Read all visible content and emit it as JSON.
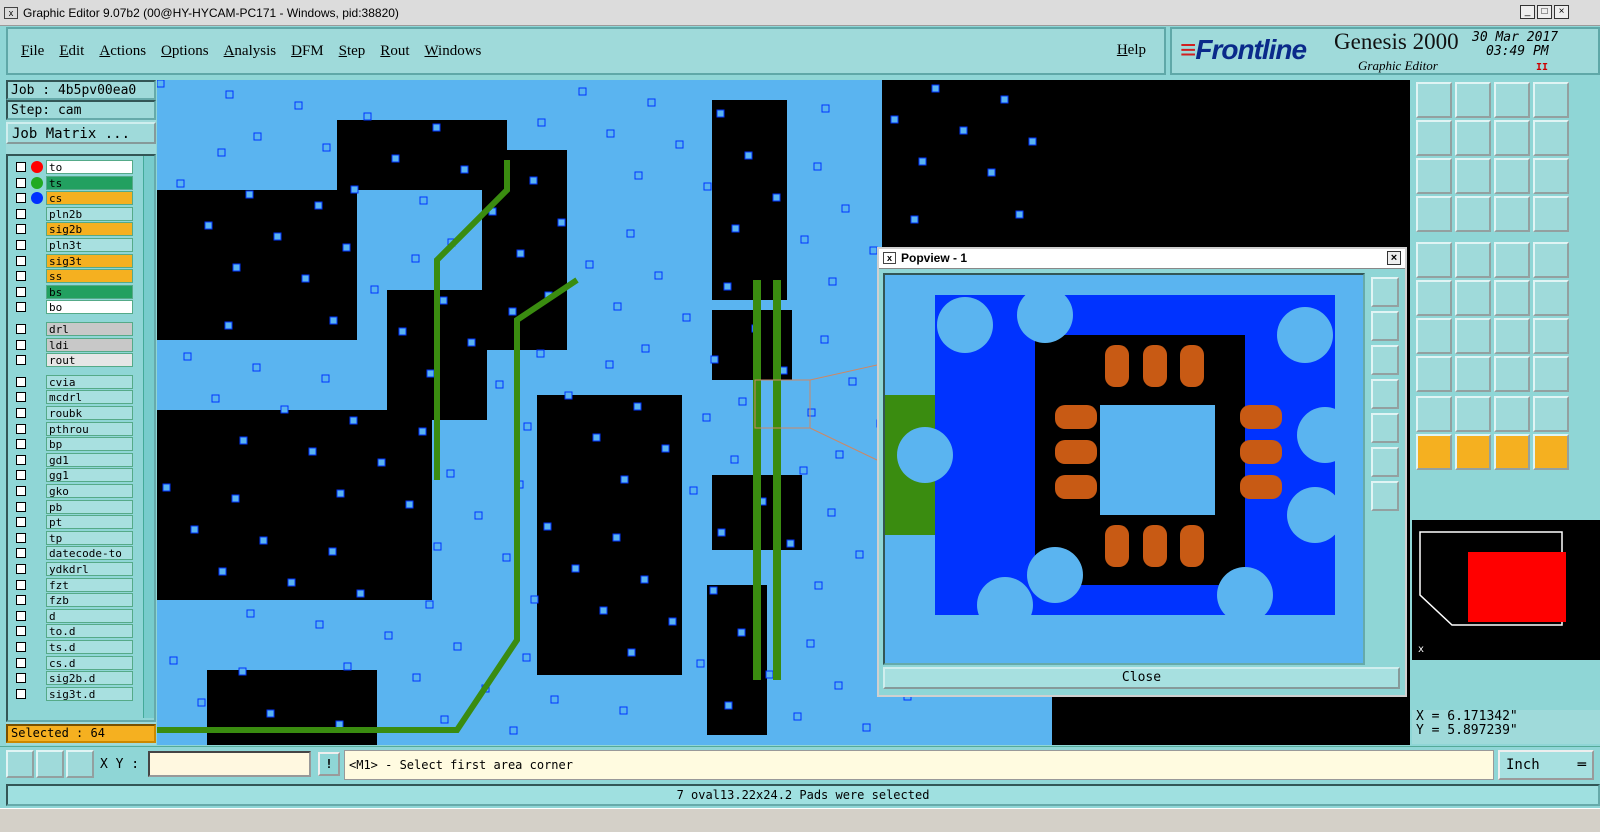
{
  "window": {
    "title": "Graphic Editor 9.07b2 (00@HY-HYCAM-PC171 - Windows, pid:38820)"
  },
  "menu": {
    "items": [
      "File",
      "Edit",
      "Actions",
      "Options",
      "Analysis",
      "DFM",
      "Step",
      "Rout",
      "Windows"
    ],
    "help": "Help"
  },
  "brand": {
    "logo": "Frontline",
    "product": "Genesis 2000",
    "subtitle": "Graphic Editor",
    "date": "30 Mar 2017",
    "time": "03:49 PM"
  },
  "job": {
    "name": "Job : 4b5pv00ea0",
    "step": "Step: cam",
    "matrix_button": "Job Matrix ..."
  },
  "layers": [
    {
      "name": "to",
      "color": "#ffffff"
    },
    {
      "name": "ts",
      "color": "#22a060"
    },
    {
      "name": "cs",
      "color": "#f5b020"
    },
    {
      "name": "pln2b",
      "color": "#a8e0e0"
    },
    {
      "name": "sig2b",
      "color": "#f5b020"
    },
    {
      "name": "pln3t",
      "color": "#a8e0e0"
    },
    {
      "name": "sig3t",
      "color": "#f5b020"
    },
    {
      "name": "ss",
      "color": "#f5b020"
    },
    {
      "name": "bs",
      "color": "#22a060"
    },
    {
      "name": "bo",
      "color": "#ffffff"
    },
    {
      "name": "drl",
      "color": "#c8c8c8"
    },
    {
      "name": "ldi",
      "color": "#c8c8c8"
    },
    {
      "name": "rout",
      "color": "#e6e6e6"
    },
    {
      "name": "cvia",
      "color": "#a8e0e0"
    },
    {
      "name": "mcdrl",
      "color": "#a8e0e0"
    },
    {
      "name": "roubk",
      "color": "#a8e0e0"
    },
    {
      "name": "pthrou",
      "color": "#a8e0e0"
    },
    {
      "name": "bp",
      "color": "#a8e0e0"
    },
    {
      "name": "gd1",
      "color": "#a8e0e0"
    },
    {
      "name": "gg1",
      "color": "#a8e0e0"
    },
    {
      "name": "gko",
      "color": "#a8e0e0"
    },
    {
      "name": "pb",
      "color": "#a8e0e0"
    },
    {
      "name": "pt",
      "color": "#a8e0e0"
    },
    {
      "name": "tp",
      "color": "#a8e0e0"
    },
    {
      "name": "datecode-to",
      "color": "#a8e0e0"
    },
    {
      "name": "ydkdrl",
      "color": "#a8e0e0"
    },
    {
      "name": "fzt",
      "color": "#a8e0e0"
    },
    {
      "name": "fzb",
      "color": "#a8e0e0"
    },
    {
      "name": "d",
      "color": "#a8e0e0"
    },
    {
      "name": "to.d",
      "color": "#a8e0e0"
    },
    {
      "name": "ts.d",
      "color": "#a8e0e0"
    },
    {
      "name": "cs.d",
      "color": "#a8e0e0"
    },
    {
      "name": "sig2b.d",
      "color": "#a8e0e0"
    },
    {
      "name": "sig3t.d",
      "color": "#a8e0e0"
    }
  ],
  "selected": "Selected : 64",
  "popview": {
    "title": "Popview - 1",
    "close_label": "Close"
  },
  "coords": {
    "x": "X = 6.171342\"",
    "y": "Y = 5.897239\""
  },
  "toolbar_bottom": {
    "xy_label": "X Y :",
    "xy_value": "",
    "prompt": "<M1> - Select first area corner",
    "units": "Inch"
  },
  "status": "7 oval13.22x24.2 Pads were selected",
  "colors": {
    "pcb_cyan": "#5ab4f0",
    "pcb_blue": "#0033ff",
    "pcb_green": "#3a8c10",
    "pad_orange": "#c85a14",
    "background": "#000000"
  }
}
